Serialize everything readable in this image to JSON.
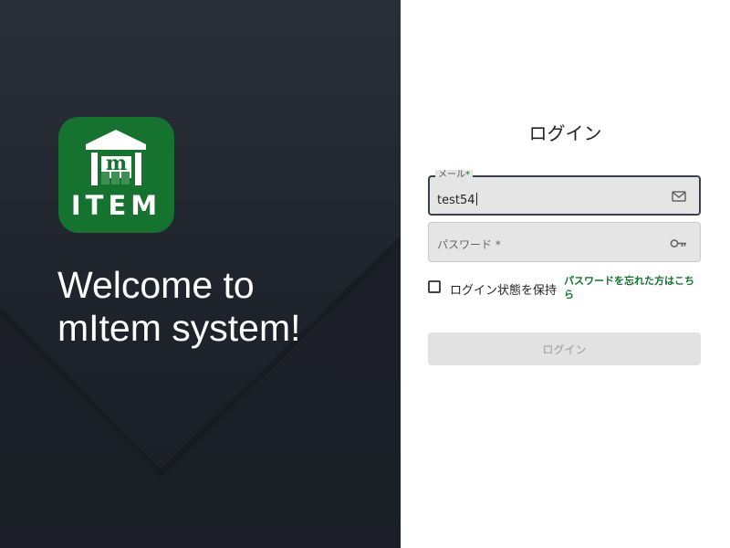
{
  "hero": {
    "logo_text": "ITEM",
    "logo_letter": "m",
    "welcome_line1": "Welcome to",
    "welcome_line2": "mItem system!"
  },
  "login": {
    "title": "ログイン",
    "email": {
      "label": "メール",
      "required_mark": "*",
      "value": "test54",
      "icon": "mail-icon"
    },
    "password": {
      "placeholder": "パスワード *",
      "value": "",
      "icon": "key-icon"
    },
    "remember_label": "ログイン状態を保持",
    "remember_checked": false,
    "forgot_link": "パスワードを忘れた方はこちら",
    "submit_label": "ログイン"
  },
  "colors": {
    "brand_green": "#15722f",
    "hero_bg": "#1f232c",
    "disabled_button_bg": "#e2e2e2"
  }
}
